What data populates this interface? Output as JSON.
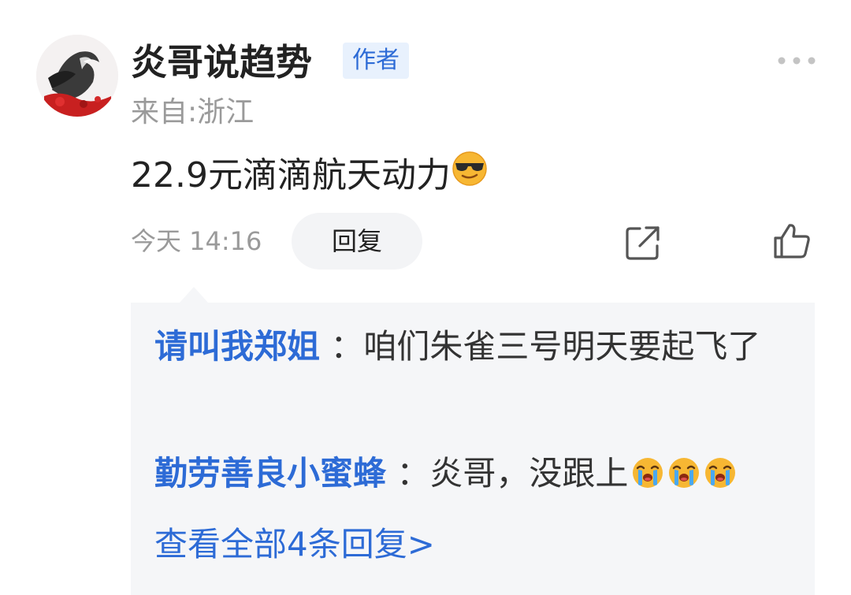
{
  "comment": {
    "author_name": "炎哥说趋势",
    "author_badge": "作者",
    "location": "来自:浙江",
    "text": "22.9元滴滴航天动力",
    "text_emoji": "cool-face-emoji",
    "time": "今天 14:16",
    "reply_label": "回复",
    "icons": {
      "more": "more-dots-icon",
      "share": "share-icon",
      "like": "thumbs-up-icon"
    }
  },
  "replies": [
    {
      "user": "请叫我郑姐",
      "colon": "：",
      "text": "咱们朱雀三号明天要起飞了"
    },
    {
      "user": "勤劳善良小蜜蜂",
      "colon": "：",
      "text": "炎哥，没跟上",
      "emoji": "crying-face-emoji",
      "emoji_count": 3
    }
  ],
  "view_all": "查看全部4条回复>",
  "colors": {
    "link_blue": "#2d6bd6",
    "badge_bg": "#e8f1fd",
    "gray_text": "#9a9a9a",
    "reply_box_bg": "#f5f6f8"
  }
}
